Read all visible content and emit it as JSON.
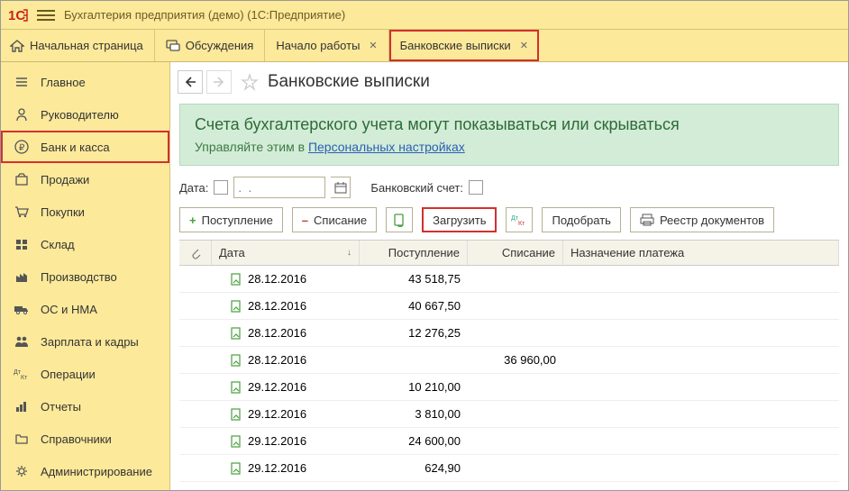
{
  "titlebar": {
    "text": "Бухгалтерия предприятия (демо)  (1С:Предприятие)"
  },
  "tabs": {
    "home": "Начальная страница",
    "discuss": "Обсуждения",
    "start": "Начало работы",
    "bank": "Банковские выписки"
  },
  "sidebar": {
    "items": [
      "Главное",
      "Руководителю",
      "Банк и касса",
      "Продажи",
      "Покупки",
      "Склад",
      "Производство",
      "ОС и НМА",
      "Зарплата и кадры",
      "Операции",
      "Отчеты",
      "Справочники",
      "Администрирование"
    ]
  },
  "page": {
    "title": "Банковские выписки"
  },
  "banner": {
    "title": "Счета бухгалтерского учета могут показываться или скрываться",
    "sub_prefix": "Управляйте этим в ",
    "link": "Персональных настройках"
  },
  "filters": {
    "date_label": "Дата:",
    "date_placeholder": ".  .",
    "account_label": "Банковский счет:"
  },
  "toolbar": {
    "in": "Поступление",
    "out": "Списание",
    "load": "Загрузить",
    "pick": "Подобрать",
    "registry": "Реестр документов"
  },
  "grid": {
    "headers": {
      "date": "Дата",
      "in": "Поступление",
      "out": "Списание",
      "purpose": "Назначение платежа"
    },
    "rows": [
      {
        "date": "28.12.2016",
        "in": "43 518,75",
        "out": ""
      },
      {
        "date": "28.12.2016",
        "in": "40 667,50",
        "out": ""
      },
      {
        "date": "28.12.2016",
        "in": "12 276,25",
        "out": ""
      },
      {
        "date": "28.12.2016",
        "in": "",
        "out": "36 960,00"
      },
      {
        "date": "29.12.2016",
        "in": "10 210,00",
        "out": ""
      },
      {
        "date": "29.12.2016",
        "in": "3 810,00",
        "out": ""
      },
      {
        "date": "29.12.2016",
        "in": "24 600,00",
        "out": ""
      },
      {
        "date": "29.12.2016",
        "in": "624,90",
        "out": ""
      }
    ]
  }
}
